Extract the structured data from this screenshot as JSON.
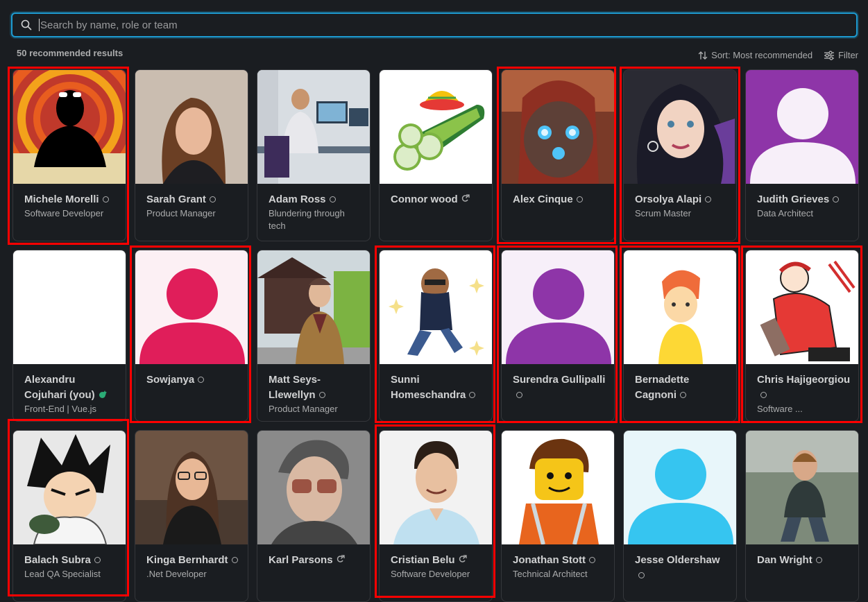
{
  "search": {
    "placeholder": "Search by name, role or team"
  },
  "results_count": "50 recommended results",
  "sort_label": "Sort: Most recommended",
  "filter_label": "Filter",
  "people": [
    {
      "name": "Michele Morelli",
      "role": "Software Developer",
      "status": "away",
      "highlight": true
    },
    {
      "name": "Sarah Grant",
      "role": "Product Manager",
      "status": "away"
    },
    {
      "name": "Adam Ross",
      "role": "Blundering through tech",
      "status": "away"
    },
    {
      "name": "Connor wood",
      "role": "",
      "status": "external"
    },
    {
      "name": "Alex Cinque",
      "role": "",
      "status": "away",
      "highlight": true
    },
    {
      "name": "Orsolya Alapi",
      "role": "Scrum Master",
      "status": "away",
      "highlight": true
    },
    {
      "name": "Judith Grieves",
      "role": "Data Architect",
      "status": "away"
    },
    {
      "name": "Alexandru Cojuhari (you)",
      "role": "Front-End | Vue.js",
      "status": "active"
    },
    {
      "name": "Sowjanya",
      "role": "",
      "status": "away",
      "highlight": true
    },
    {
      "name": "Matt Seys-Llewellyn",
      "role": "Product Manager",
      "status": "away"
    },
    {
      "name": "Sunni Homeschandra",
      "role": "",
      "status": "away",
      "highlight": true
    },
    {
      "name": "Surendra Gullipalli",
      "role": "",
      "status": "away",
      "highlight": true
    },
    {
      "name": "Bernadette Cagnoni",
      "role": "",
      "status": "away",
      "highlight": true
    },
    {
      "name": "Chris Hajigeorgiou",
      "role": "Software ...",
      "status": "away",
      "highlight": true
    },
    {
      "name": "Balach Subra",
      "role": "Lead QA Specialist",
      "status": "away",
      "highlight": true
    },
    {
      "name": "Kinga Bernhardt",
      "role": ".Net Developer",
      "status": "away"
    },
    {
      "name": "Karl Parsons",
      "role": "",
      "status": "external"
    },
    {
      "name": "Cristian Belu",
      "role": "Software Developer",
      "status": "external",
      "highlight": true
    },
    {
      "name": "Jonathan Stott",
      "role": "Technical Architect",
      "status": "away"
    },
    {
      "name": "Jesse Oldershaw",
      "role": "",
      "status": "away"
    },
    {
      "name": "Dan Wright",
      "role": "",
      "status": "away"
    }
  ],
  "colors": {
    "accent": "#1d9bd1",
    "highlight": "#ff0000",
    "active": "#2bac76"
  }
}
